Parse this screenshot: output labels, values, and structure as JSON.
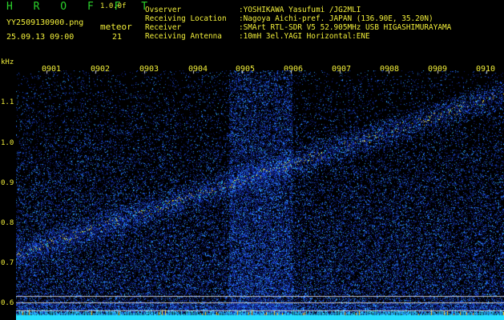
{
  "header": {
    "brand": "H R O F F T",
    "version": "1.0.0f",
    "filename": "YY2509130900.png",
    "mode": "meteor",
    "datetime": "25.09.13 09:00",
    "count": "21"
  },
  "meta": [
    {
      "label": "Ovserver",
      "value": ":YOSHIKAWA Yasufumi /JG2MLI"
    },
    {
      "label": "Receiving Location",
      "value": ":Nagoya Aichi-pref. JAPAN (136.90E, 35.20N)"
    },
    {
      "label": "Receiver",
      "value": ":SMArt RTL-SDR V5 52.905MHz USB HIGASHIMURAYAMA"
    },
    {
      "label": "Receiving Antenna",
      "value": ":10mH 3el.YAGI Horizontal:ENE"
    }
  ],
  "spectrogram": {
    "y_unit": "kHz",
    "y_ticks": [
      "1.1",
      "1.0",
      "0.9",
      "0.8",
      "0.7",
      "0.6"
    ],
    "time_labels": [
      "0901",
      "0902",
      "0903",
      "0904",
      "0905",
      "0906",
      "0907",
      "0908",
      "0909",
      "0910"
    ],
    "colors": {
      "background": "#000000",
      "low": "#0a1a6e",
      "mid": "#1f5bff",
      "high": "#27e0ff",
      "peak": "#ffe83a",
      "text_green": "#2bd12b",
      "text_yellow": "#f2ef3a"
    }
  }
}
